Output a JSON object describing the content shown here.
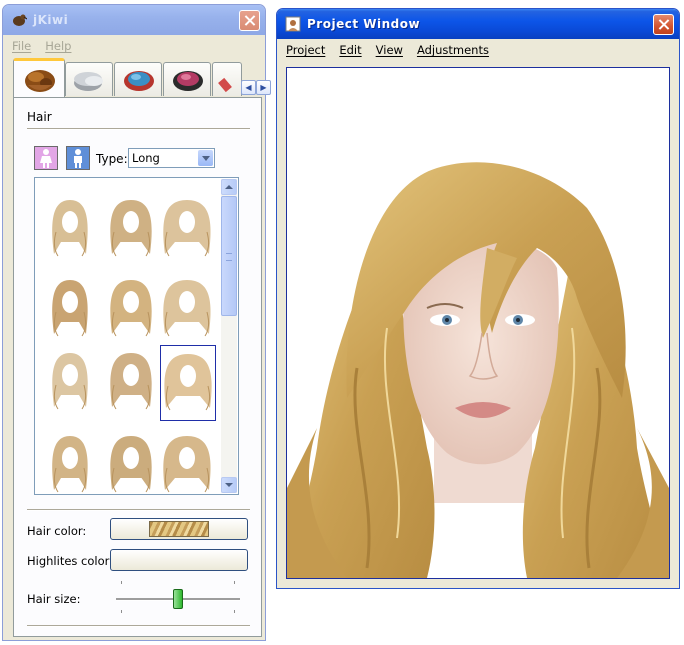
{
  "jkiwi": {
    "title": "jKiwi",
    "menu": [
      "File",
      "Help"
    ],
    "tabs": [
      "hair",
      "makeup-base",
      "eyeshadow",
      "blush",
      "lipstick"
    ],
    "section_title": "Hair",
    "gender": "female",
    "type_label": "Type:",
    "type_value": "Long",
    "hair_color_label": "Hair color:",
    "highlites_color_label": "Highlites color:",
    "hair_size_label": "Hair size:",
    "hair_size_value": 0.5,
    "hair_color": "#d4b06a",
    "selected_style_index": 8
  },
  "project": {
    "title": "Project Window",
    "menu": [
      "Project",
      "Edit",
      "View",
      "Adjustments"
    ]
  },
  "colors": {
    "title_active": "#0a50d8",
    "title_inactive": "#8ea8e6",
    "window_bg": "#ece9d8",
    "hair": "#c9a053",
    "skin": "#f1dbd0"
  }
}
